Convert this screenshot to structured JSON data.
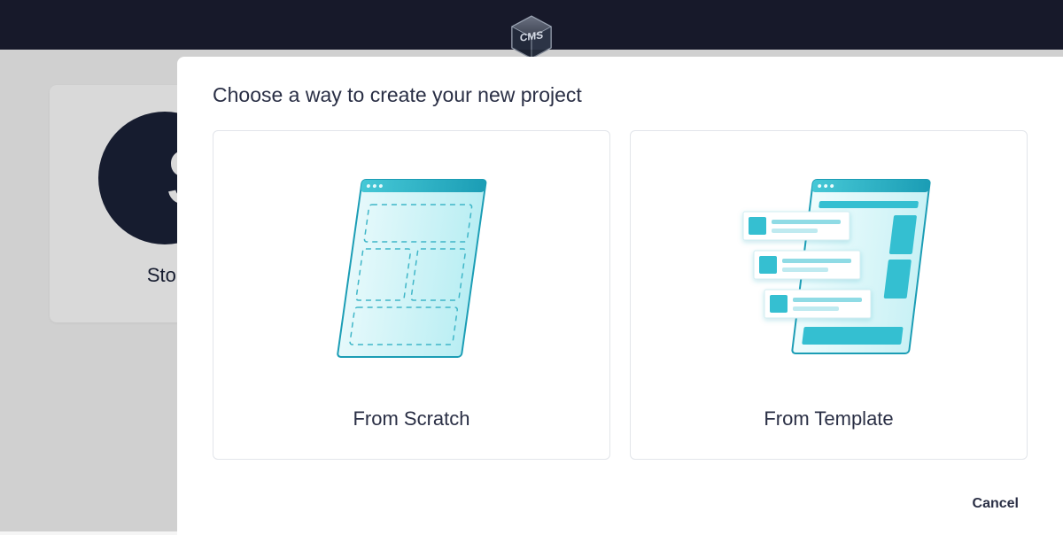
{
  "header": {
    "logo_label": "cms-logo-icon"
  },
  "background": {
    "project_initial": "S",
    "project_name": "Stor"
  },
  "modal": {
    "title": "Choose a way to create your new project",
    "options": [
      {
        "label": "From Scratch",
        "icon": "scratch-illustration-icon"
      },
      {
        "label": "From Template",
        "icon": "template-illustration-icon"
      }
    ],
    "cancel_label": "Cancel"
  }
}
